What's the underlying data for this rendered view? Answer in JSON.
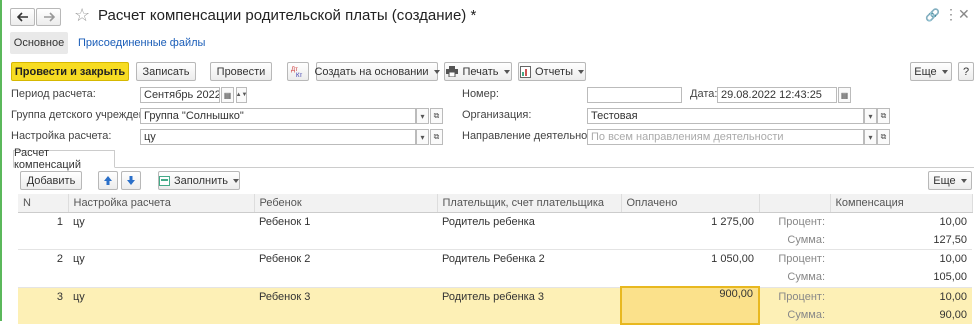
{
  "window": {
    "title": "Расчет компенсации родительской платы (создание) *",
    "nav_tabs": [
      "Основное",
      "Присоединенные файлы"
    ]
  },
  "toolbar": {
    "post_close": "Провести и закрыть",
    "save": "Записать",
    "post": "Провести",
    "create_based": "Создать на основании",
    "print": "Печать",
    "reports": "Отчеты",
    "more": "Еще",
    "help": "?"
  },
  "form": {
    "period_label": "Период расчета:",
    "period_value": "Сентябрь 2022",
    "number_label": "Номер:",
    "number_value": "",
    "date_label": "Дата:",
    "date_value": "29.08.2022 12:43:25",
    "group_label": "Группа детского учреждения:",
    "group_value": "Группа \"Солнышко\"",
    "org_label": "Организация:",
    "org_value": "Тестовая",
    "settings_label": "Настройка расчета:",
    "settings_value": "цу",
    "direction_label": "Направление деятельности:",
    "direction_placeholder": "По всем направлениям деятельности"
  },
  "tabs": [
    "Расчет компенсаций"
  ],
  "table_toolbar": {
    "add": "Добавить",
    "fill": "Заполнить",
    "more": "Еще"
  },
  "table": {
    "columns": [
      "N",
      "Настройка расчета",
      "Ребенок",
      "Плательщик, счет плательщика",
      "Оплачено",
      "",
      "Компенсация"
    ],
    "sub_labels": {
      "percent": "Процент:",
      "sum": "Сумма:"
    },
    "rows": [
      {
        "n": "1",
        "setting": "цу",
        "child": "Ребенок 1",
        "payer": "Родитель ребенка",
        "paid": "1 275,00",
        "percent": "10,00",
        "sum": "127,50"
      },
      {
        "n": "2",
        "setting": "цу",
        "child": "Ребенок 2",
        "payer": "Родитель Ребенка 2",
        "paid": "1 050,00",
        "percent": "10,00",
        "sum": "105,00"
      },
      {
        "n": "3",
        "setting": "цу",
        "child": "Ребенок 3",
        "payer": "Родитель ребенка 3",
        "paid": "900,00",
        "percent": "10,00",
        "sum": "90,00"
      }
    ]
  }
}
